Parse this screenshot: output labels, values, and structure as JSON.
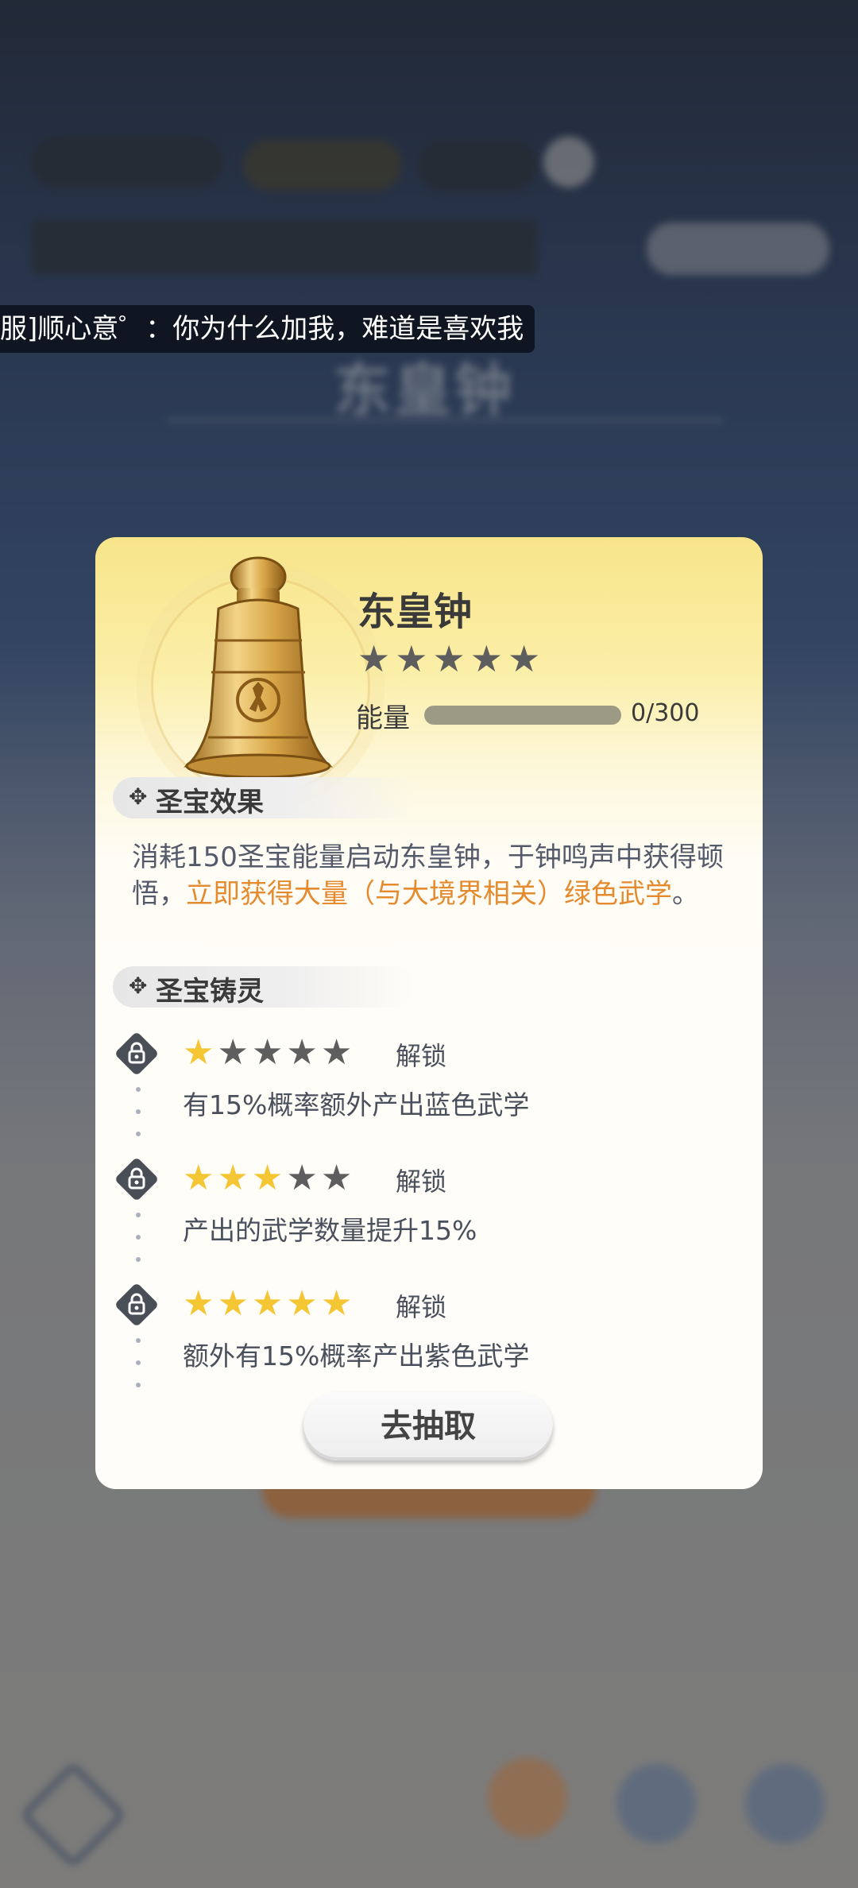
{
  "chat_message": "服]顺心意゜：你为什么加我，难道是喜欢我",
  "item": {
    "name": "东皇钟",
    "rarity_stars": 5,
    "energy_label": "能量",
    "energy_current": 0,
    "energy_max": 300,
    "energy_text": "0/300"
  },
  "effect_section": {
    "title": "圣宝效果",
    "icon": "diamond-sparkle-icon",
    "desc_plain_1": "消耗150圣宝能量启动东皇钟，于钟鸣声中获得顿悟，",
    "desc_highlight": "立即获得大量（与大境界相关）绿色武学",
    "desc_plain_2": "。"
  },
  "forge_section": {
    "title": "圣宝铸灵",
    "icon": "diamond-sparkle-icon",
    "tiers": [
      {
        "stars_lit": 1,
        "stars_total": 5,
        "unlock_label": "解锁",
        "desc": "有15%概率额外产出蓝色武学",
        "lock_icon": "lock-icon"
      },
      {
        "stars_lit": 3,
        "stars_total": 5,
        "unlock_label": "解锁",
        "desc": "产出的武学数量提升15%",
        "lock_icon": "lock-icon"
      },
      {
        "stars_lit": 5,
        "stars_total": 5,
        "unlock_label": "解锁",
        "desc": "额外有15%概率产出紫色武学",
        "lock_icon": "lock-icon"
      }
    ]
  },
  "action_button": "去抽取",
  "colors": {
    "highlight": "#e48a2f",
    "star_on": "#f5c634",
    "star_off": "#5e5e5e",
    "modal_header": "#f8e58a"
  }
}
